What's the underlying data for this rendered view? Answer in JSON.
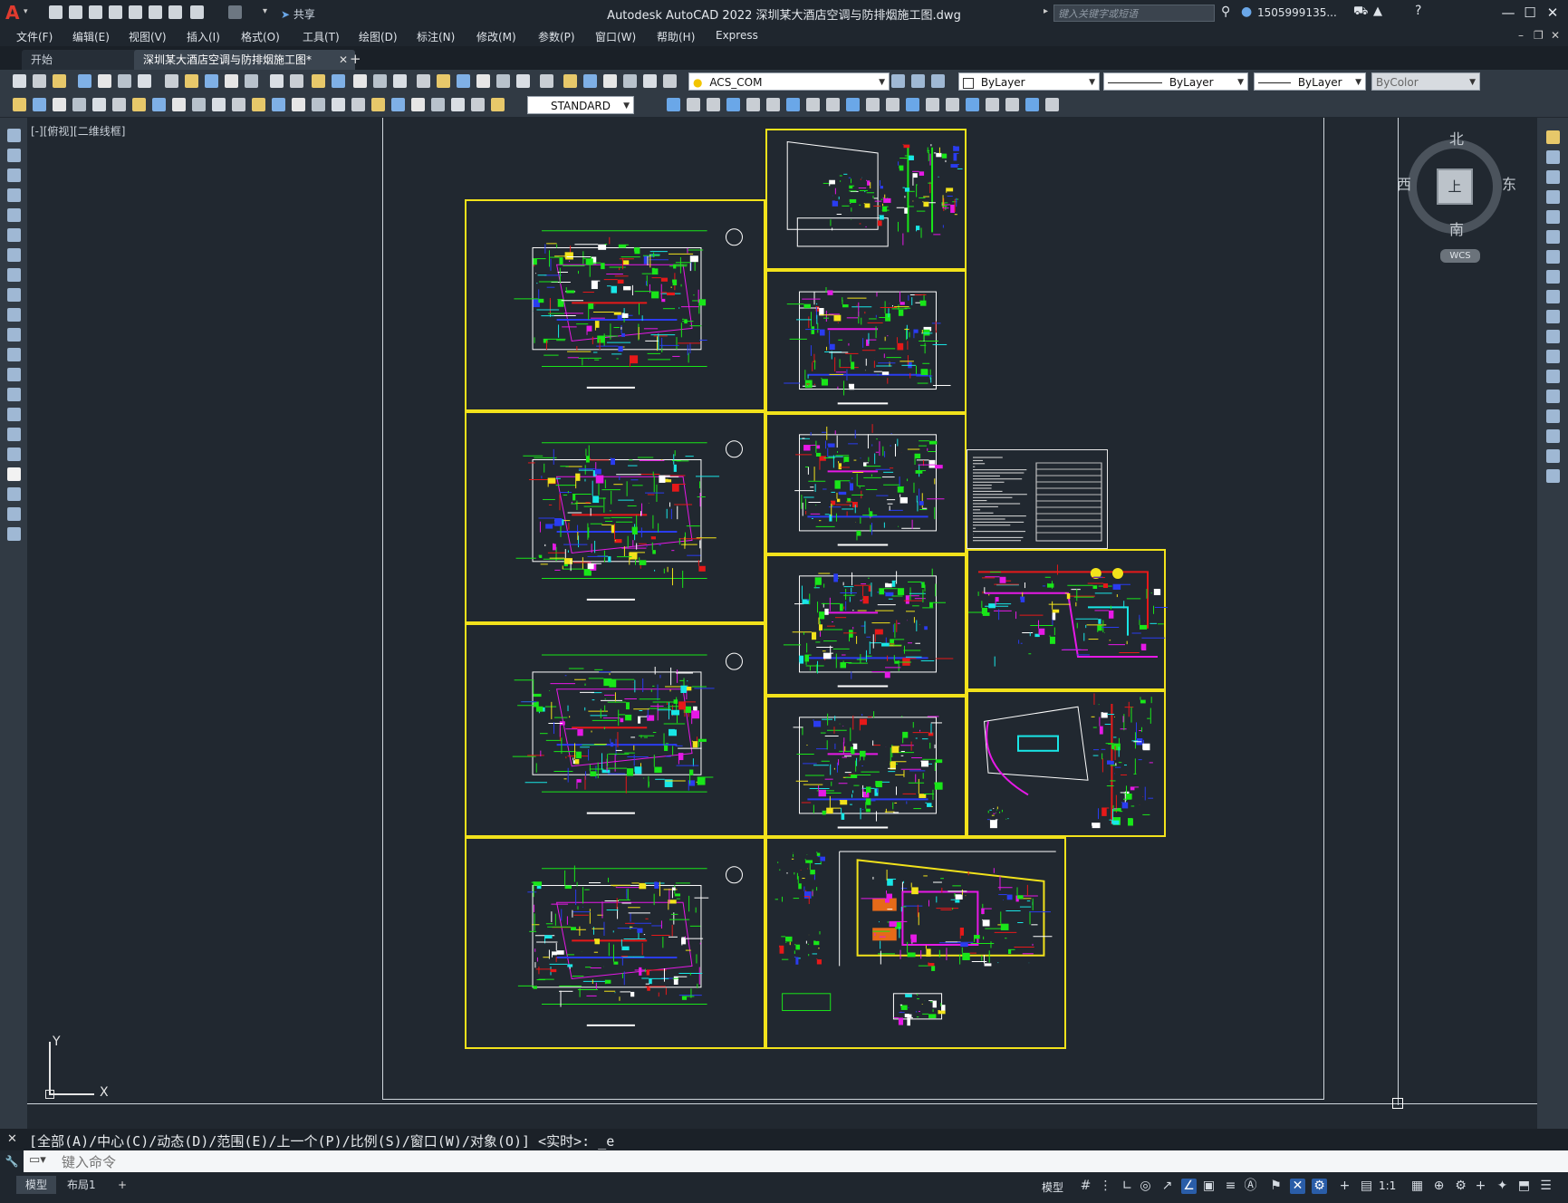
{
  "app": {
    "logo": "A",
    "window_title": "Autodesk AutoCAD 2022    深圳某大酒店空调与防排烟施工图.dwg",
    "share_label": "共享",
    "search_placeholder": "键入关键字或短语",
    "user": "1505999135...",
    "window_controls": [
      "—",
      "☐",
      "✕"
    ]
  },
  "menu": [
    "文件(F)",
    "编辑(E)",
    "视图(V)",
    "插入(I)",
    "格式(O)",
    "工具(T)",
    "绘图(D)",
    "标注(N)",
    "修改(M)",
    "参数(P)",
    "窗口(W)",
    "帮助(H)",
    "Express"
  ],
  "tabs": [
    {
      "label": "开始"
    },
    {
      "label": "深圳某大酒店空调与防排烟施工图*"
    }
  ],
  "tab_close": "✕",
  "tab_add": "+",
  "properties": {
    "layer": "ACS_COM",
    "color": "ByLayer",
    "linetype": "ByLayer",
    "lineweight": "ByLayer",
    "plotstyle": "ByColor",
    "textstyle": "STANDARD"
  },
  "viewport": {
    "label": "[-][俯视][二维线框]",
    "ucs_y": "Y",
    "ucs_x": "X"
  },
  "viewcube": {
    "north": "北",
    "south": "南",
    "east": "东",
    "west": "西",
    "face": "上",
    "wcs": "WCS"
  },
  "command": {
    "history": "[全部(A)/中心(C)/动态(D)/范围(E)/上一个(P)/比例(S)/窗口(W)/对象(O)] <实时>: _e",
    "placeholder": "键入命令"
  },
  "status": {
    "tabs": [
      "模型",
      "布局1"
    ],
    "add": "+",
    "model_label": "模型",
    "scale": "1:1"
  }
}
